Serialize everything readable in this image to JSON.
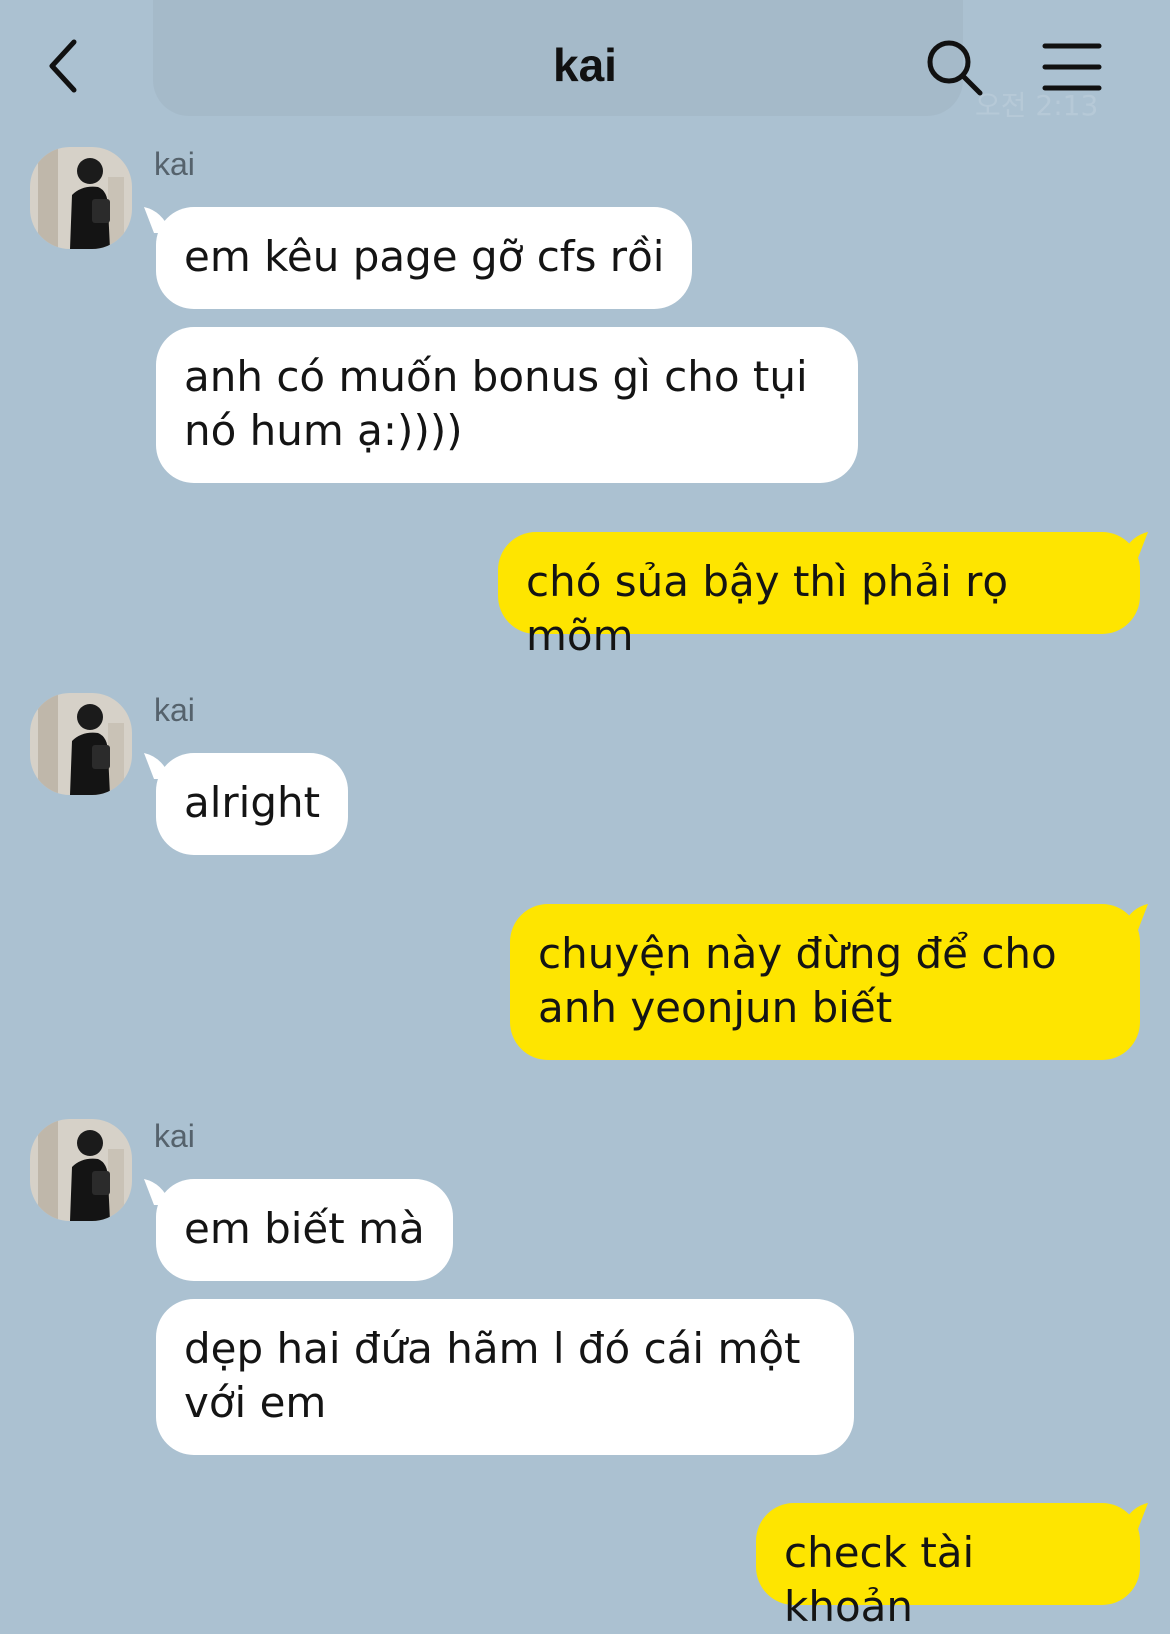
{
  "header": {
    "title": "kai",
    "ghost_time": "오전 2:13",
    "back_icon": "chevron-left-icon",
    "search_icon": "search-icon",
    "menu_icon": "hamburger-menu-icon"
  },
  "colors": {
    "background": "#abc1d1",
    "incoming_bubble": "#ffffff",
    "outgoing_bubble": "#fee500"
  },
  "messages": [
    {
      "sender": "kai",
      "bubbles": [
        "em kêu page gỡ cfs rồi",
        "anh có muốn bonus gì cho tụi nó hum ạ:))))"
      ]
    },
    {
      "sender": "me",
      "bubbles": [
        "chó sủa bậy thì phải rọ mõm"
      ]
    },
    {
      "sender": "kai",
      "bubbles": [
        "alright"
      ]
    },
    {
      "sender": "me",
      "bubbles": [
        "chuyện này đừng để cho anh yeonjun biết"
      ]
    },
    {
      "sender": "kai",
      "bubbles": [
        "em biết mà",
        "dẹp hai đứa hãm l đó cái một với em"
      ]
    },
    {
      "sender": "me",
      "bubbles": [
        "check tài khoản"
      ]
    }
  ]
}
